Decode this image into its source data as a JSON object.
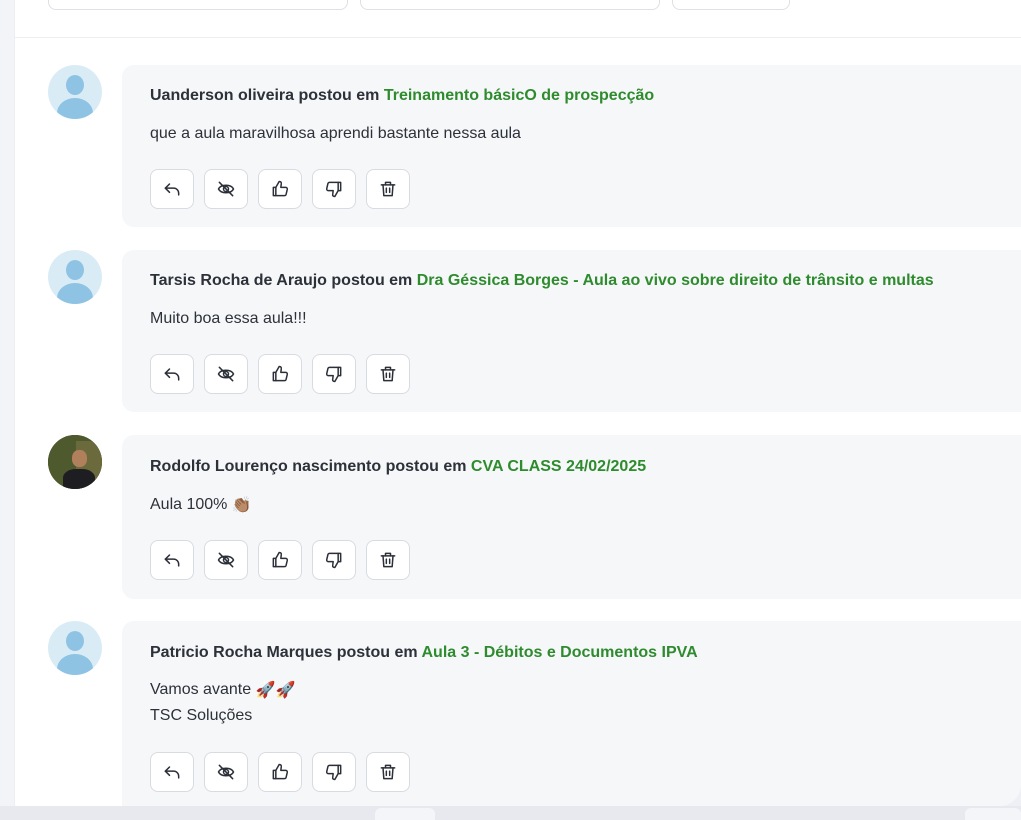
{
  "comments": [
    {
      "author": "Uanderson oliveira",
      "posted_in": "postou em",
      "target": "Treinamento básicO de prospecção",
      "lines": [
        "que a aula maravilhosa aprendi bastante nessa aula"
      ],
      "avatar": "default-avatar"
    },
    {
      "author": "Tarsis Rocha de Araujo",
      "posted_in": "postou em",
      "target": "Dra Géssica Borges - Aula ao vivo sobre direito de trânsito e multas",
      "lines": [
        "Muito boa essa aula!!!"
      ],
      "avatar": "default-avatar"
    },
    {
      "author": "Rodolfo Lourenço nascimento",
      "posted_in": "postou em",
      "target": "CVA CLASS 24/02/2025",
      "lines": [
        "Aula 100%"
      ],
      "emoji": "👏🏽",
      "avatar": "photo-avatar"
    },
    {
      "author": "Patricio Rocha Marques",
      "posted_in": "postou em",
      "target": "Aula 3 - Débitos e Documentos IPVA",
      "lines": [
        "Vamos avante",
        "TSC Soluções"
      ],
      "emoji": "🚀🚀",
      "avatar": "default-avatar"
    }
  ],
  "actions": [
    "reply-icon",
    "eye-off-icon",
    "thumbs-up-icon",
    "thumbs-down-icon",
    "trash-icon"
  ],
  "colors": {
    "link": "#2e8b2e",
    "card": "#f6f7f9",
    "avatar_default": "#8fc3e4"
  }
}
